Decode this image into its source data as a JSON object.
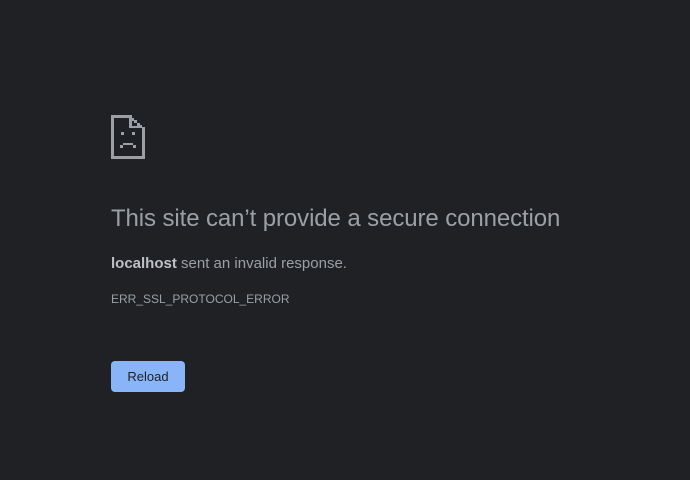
{
  "error_page": {
    "icon": "sad-document-icon",
    "heading": "This site can’t provide a secure connection",
    "host": "localhost",
    "summary_rest": " sent an invalid response.",
    "error_code": "ERR_SSL_PROTOCOL_ERROR",
    "reload_label": "Reload"
  },
  "colors": {
    "background": "#202124",
    "text": "#9aa0a6",
    "button": "#8ab4f8",
    "button_text": "#202124"
  }
}
